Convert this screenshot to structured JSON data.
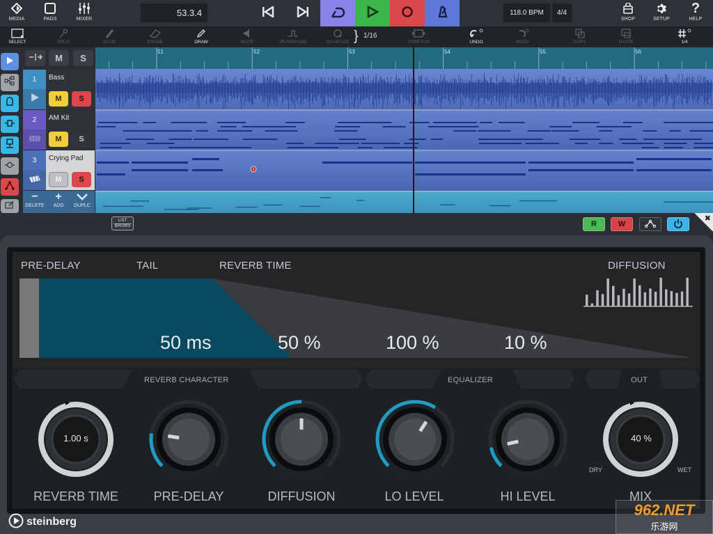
{
  "topbar": {
    "left_buttons": [
      {
        "label": "MEDIA",
        "icon": "media-icon"
      },
      {
        "label": "PADS",
        "icon": "pads-icon"
      },
      {
        "label": "MIXER",
        "icon": "mixer-icon"
      }
    ],
    "position": "53.3.4",
    "transport": [
      {
        "name": "go-to-previous-marker",
        "icon": "skip-back-icon",
        "color": "#2e3238"
      },
      {
        "name": "go-to-next-marker",
        "icon": "skip-forward-icon",
        "color": "#2e3238"
      },
      {
        "name": "cycle",
        "icon": "cycle-icon",
        "color": "#8a82e6"
      },
      {
        "name": "play",
        "icon": "play-icon",
        "color": "#3cb54a"
      },
      {
        "name": "record",
        "icon": "record-icon",
        "color": "#d9484b"
      },
      {
        "name": "metronome",
        "icon": "metronome-icon",
        "color": "#5d78d6"
      }
    ],
    "tempo": "118.0 BPM",
    "time_signature": "4/4",
    "right_buttons": [
      {
        "label": "SHOP",
        "icon": "shop-bag-icon"
      },
      {
        "label": "SETUP",
        "icon": "gear-icon"
      },
      {
        "label": "HELP",
        "icon": "help-icon"
      }
    ]
  },
  "toolbar": {
    "tools": [
      {
        "label": "SELECT",
        "icon": "select-icon",
        "enabled": true
      },
      {
        "label": "SPLIT",
        "icon": "scissors-icon",
        "enabled": false
      },
      {
        "label": "GLUE",
        "icon": "glue-icon",
        "enabled": false
      },
      {
        "label": "ERASE",
        "icon": "eraser-icon",
        "enabled": false
      },
      {
        "label": "DRAW",
        "icon": "pencil-icon",
        "enabled": true
      },
      {
        "label": "MUTE",
        "icon": "speaker-icon",
        "enabled": false
      },
      {
        "label": "TRANSPOSE",
        "icon": "transpose-icon",
        "enabled": false
      },
      {
        "label": "QUANTIZE",
        "icon": "quantize-icon",
        "enabled": false
      }
    ],
    "quantize_value": "1/16",
    "tools_right": [
      {
        "label": "STRETCH",
        "icon": "stretch-icon",
        "enabled": false
      },
      {
        "label": "UNDO",
        "icon": "undo-icon",
        "enabled": true
      },
      {
        "label": "REDO",
        "icon": "redo-icon",
        "enabled": false
      },
      {
        "label": "COPY",
        "icon": "copy-icon",
        "enabled": false
      },
      {
        "label": "PASTE",
        "icon": "paste-icon",
        "enabled": false
      },
      {
        "label": "1/4",
        "icon": "grid-icon",
        "enabled": true
      }
    ]
  },
  "track_header": {
    "global_mute": "M",
    "global_solo": "S"
  },
  "tracks": [
    {
      "number": "1",
      "name": "Bass",
      "mute": "M",
      "solo": "S",
      "mute_active": true,
      "solo_active": true,
      "icon": "audio-play-icon",
      "color": "#3e8fc2"
    },
    {
      "number": "2",
      "name": "AM Kit",
      "mute": "M",
      "solo": "S",
      "mute_active": true,
      "solo_active": false,
      "icon": "drum-icon",
      "color": "#6a5bc4"
    },
    {
      "number": "3",
      "name": "Crying Pad",
      "mute": "M",
      "solo": "S",
      "mute_active": false,
      "solo_active": true,
      "icon": "keyboard-icon",
      "color": "#4a6fb6"
    }
  ],
  "track_actions": [
    {
      "label": "DELETE",
      "icon": "minus-icon"
    },
    {
      "label": "ADD",
      "icon": "plus-icon"
    },
    {
      "label": "DUPLC",
      "icon": "chevron-down-icon"
    }
  ],
  "ruler": {
    "bars": [
      "51",
      "52",
      "53",
      "54",
      "55",
      "56"
    ]
  },
  "plugin_bar": {
    "list_browse_top": "LIST",
    "list_browse_bottom": "BROWS",
    "read": "R",
    "write": "W"
  },
  "plugin": {
    "display_labels": {
      "pre_delay": "PRE-DELAY",
      "tail": "TAIL",
      "reverb_time": "REVERB TIME",
      "diffusion": "DIFFUSION"
    },
    "display_values": {
      "pre_delay": "50 ms",
      "diffusion": "50 %",
      "lo_level": "100 %",
      "hi_level": "10 %"
    },
    "sections": {
      "reverb_character": "REVERB CHARACTER",
      "equalizer": "EQUALIZER",
      "out": "OUT"
    },
    "knobs": [
      {
        "name": "reverb-time",
        "label": "REVERB TIME",
        "value": "1.00 s"
      },
      {
        "name": "pre-delay",
        "label": "PRE-DELAY",
        "value_fraction": 0.2
      },
      {
        "name": "diffusion",
        "label": "DIFFUSION",
        "value_fraction": 0.5
      },
      {
        "name": "lo-level",
        "label": "LO LEVEL",
        "value_fraction": 0.62
      },
      {
        "name": "hi-level",
        "label": "HI LEVEL",
        "value_fraction": 0.12
      },
      {
        "name": "mix",
        "label": "MIX",
        "value": "40 %",
        "dry": "DRY",
        "wet": "WET"
      }
    ],
    "brand": "steinberg"
  },
  "watermark": {
    "top": "962.NET",
    "bottom": "乐游网"
  }
}
